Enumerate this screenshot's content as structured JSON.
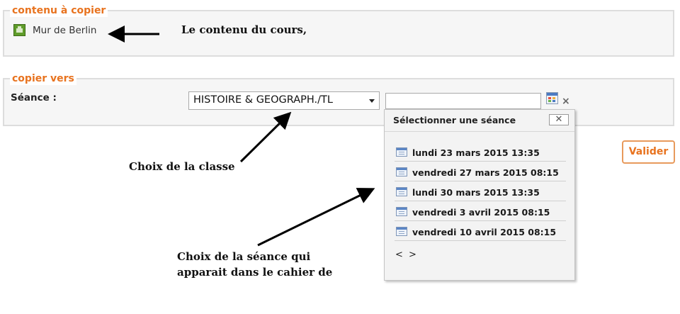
{
  "source_section": {
    "legend": "contenu à copier",
    "item_label": "Mur de Berlin",
    "item_icon": "resource-icon"
  },
  "annotations": {
    "content": "Le contenu du cours,",
    "class_choice": "Choix de la classe",
    "session_choice_line1": "Choix de la séance qui",
    "session_choice_line2": "apparait dans le cahier de"
  },
  "target_section": {
    "legend": "copier vers",
    "seance_label": "Séance :",
    "class_select_value": "HISTOIRE & GEOGRAPH./TL",
    "date_input_value": ""
  },
  "session_popup": {
    "title": "Sélectionner une séance",
    "close_label": "✕",
    "sessions": [
      "lundi 23 mars 2015 13:35",
      "vendredi 27 mars 2015 08:15",
      "lundi 30 mars 2015 13:35",
      "vendredi 3 avril 2015 08:15",
      "vendredi 10 avril 2015 08:15"
    ],
    "prev_label": "<",
    "next_label": ">"
  },
  "submit_label": "Valider",
  "colors": {
    "accent": "#e8731f",
    "panel_bg": "#f6f6f6",
    "panel_border": "#dddddd"
  }
}
